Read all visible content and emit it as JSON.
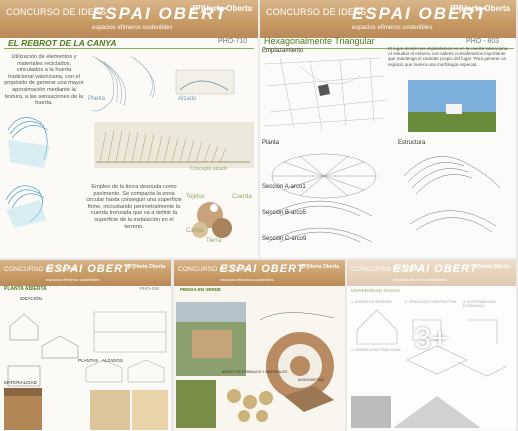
{
  "common": {
    "contest": "CONCURSO DE IDEAS",
    "brand": "ESPAI OBERT",
    "subtitle": "espacios efímeros sostenibles",
    "org": "[P]Horta Oberta"
  },
  "tile1": {
    "title": "EL REBROT DE LA CANYA",
    "code": "PHO-710",
    "p1": "Utilización de elementos y materiales reciclados, vinculados a la huerta tradicional valenciana, con el propósito de generar una mayor aproximación mediante la textura, a las sensaciones de la huerta.",
    "p2": "Empleo de la tierra desnuda como pavimento. Se compacta la zona circular hasta conseguir una superficie firme, incrustando perimetralmente la cuerda trenzada que va a definir la superficie de la instalación en el terreno.",
    "lbl_planta": "Planta",
    "lbl_alzado": "Alzado",
    "lbl_concepto": "Concepto alzado",
    "lbl_tejidos": "Tejidos",
    "lbl_cuerda": "Cuerda",
    "lbl_canya": "Canya",
    "lbl_tierra": "Tierra"
  },
  "tile2": {
    "title": "Hexagonalmente Triangular",
    "code": "PHO - 803",
    "emplazamiento": "Emplazamiento",
    "planta": "Planta",
    "estructura": "Estructura",
    "secA": "Sección A-arco1",
    "secB": "Sección B-arco5",
    "secC": "Sección C-arco9"
  },
  "tile3": {
    "title": "PLANTA ABIERTA",
    "code": "PHO-419",
    "ideacion": "IDEACIÓN",
    "plantas": "PLANTAS · ALZADOS",
    "materialidad": "MATERIALIDAD"
  },
  "tile4": {
    "title": "PIENSA EN VERDE",
    "aspectos": "ASPECTOS FORMALES Y MATERIALES",
    "axonometria": "AXONOMETRÍA"
  },
  "tile5": {
    "title": "UNIVERSIDAD SOCIAL",
    "s1": "1. DISEÑO DE INTERIOR",
    "s2": "2. SENCILLEZ CONSTRUCTIVA",
    "s3": "3. SOSTENIBILIDAD ECONÓMICA",
    "s4": "4. VERSATILIDAD FUNCIONAL"
  },
  "more": "3+"
}
